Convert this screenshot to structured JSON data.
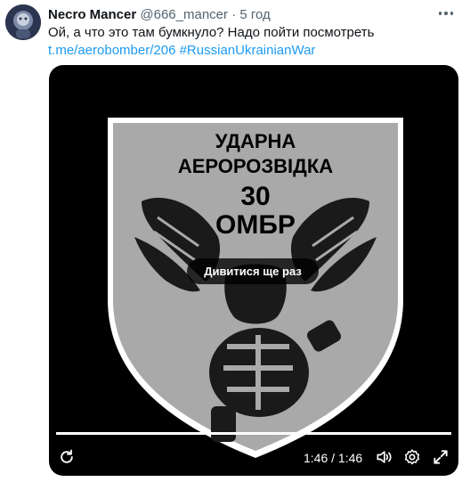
{
  "author": {
    "display_name": "Necro Mancer",
    "handle": "@666_mancer",
    "separator": "·",
    "time_ago": "5 год"
  },
  "tweet": {
    "text": "Ой, а что это там бумкнуло? Надо пойти посмотреть",
    "link_url": "t.me/aerobomber/206",
    "hashtag": "#RussianUkrainianWar"
  },
  "media": {
    "patch_lines": [
      "УДАРНА",
      "АЕРОРОЗВІДКА",
      "30",
      "ОМБР"
    ],
    "replay_label": "Дивитися ще раз",
    "timestamp": "1:46 / 1:46",
    "progress_fraction": 1.0
  },
  "icons": {
    "more": "more-icon",
    "replay": "replay-icon",
    "volume": "volume-icon",
    "settings": "settings-icon",
    "fullscreen": "fullscreen-icon"
  },
  "colors": {
    "link": "#1d9bf0",
    "secondary_text": "#536471",
    "video_background": "#000000",
    "patch_fill": "#a9a9a9"
  }
}
